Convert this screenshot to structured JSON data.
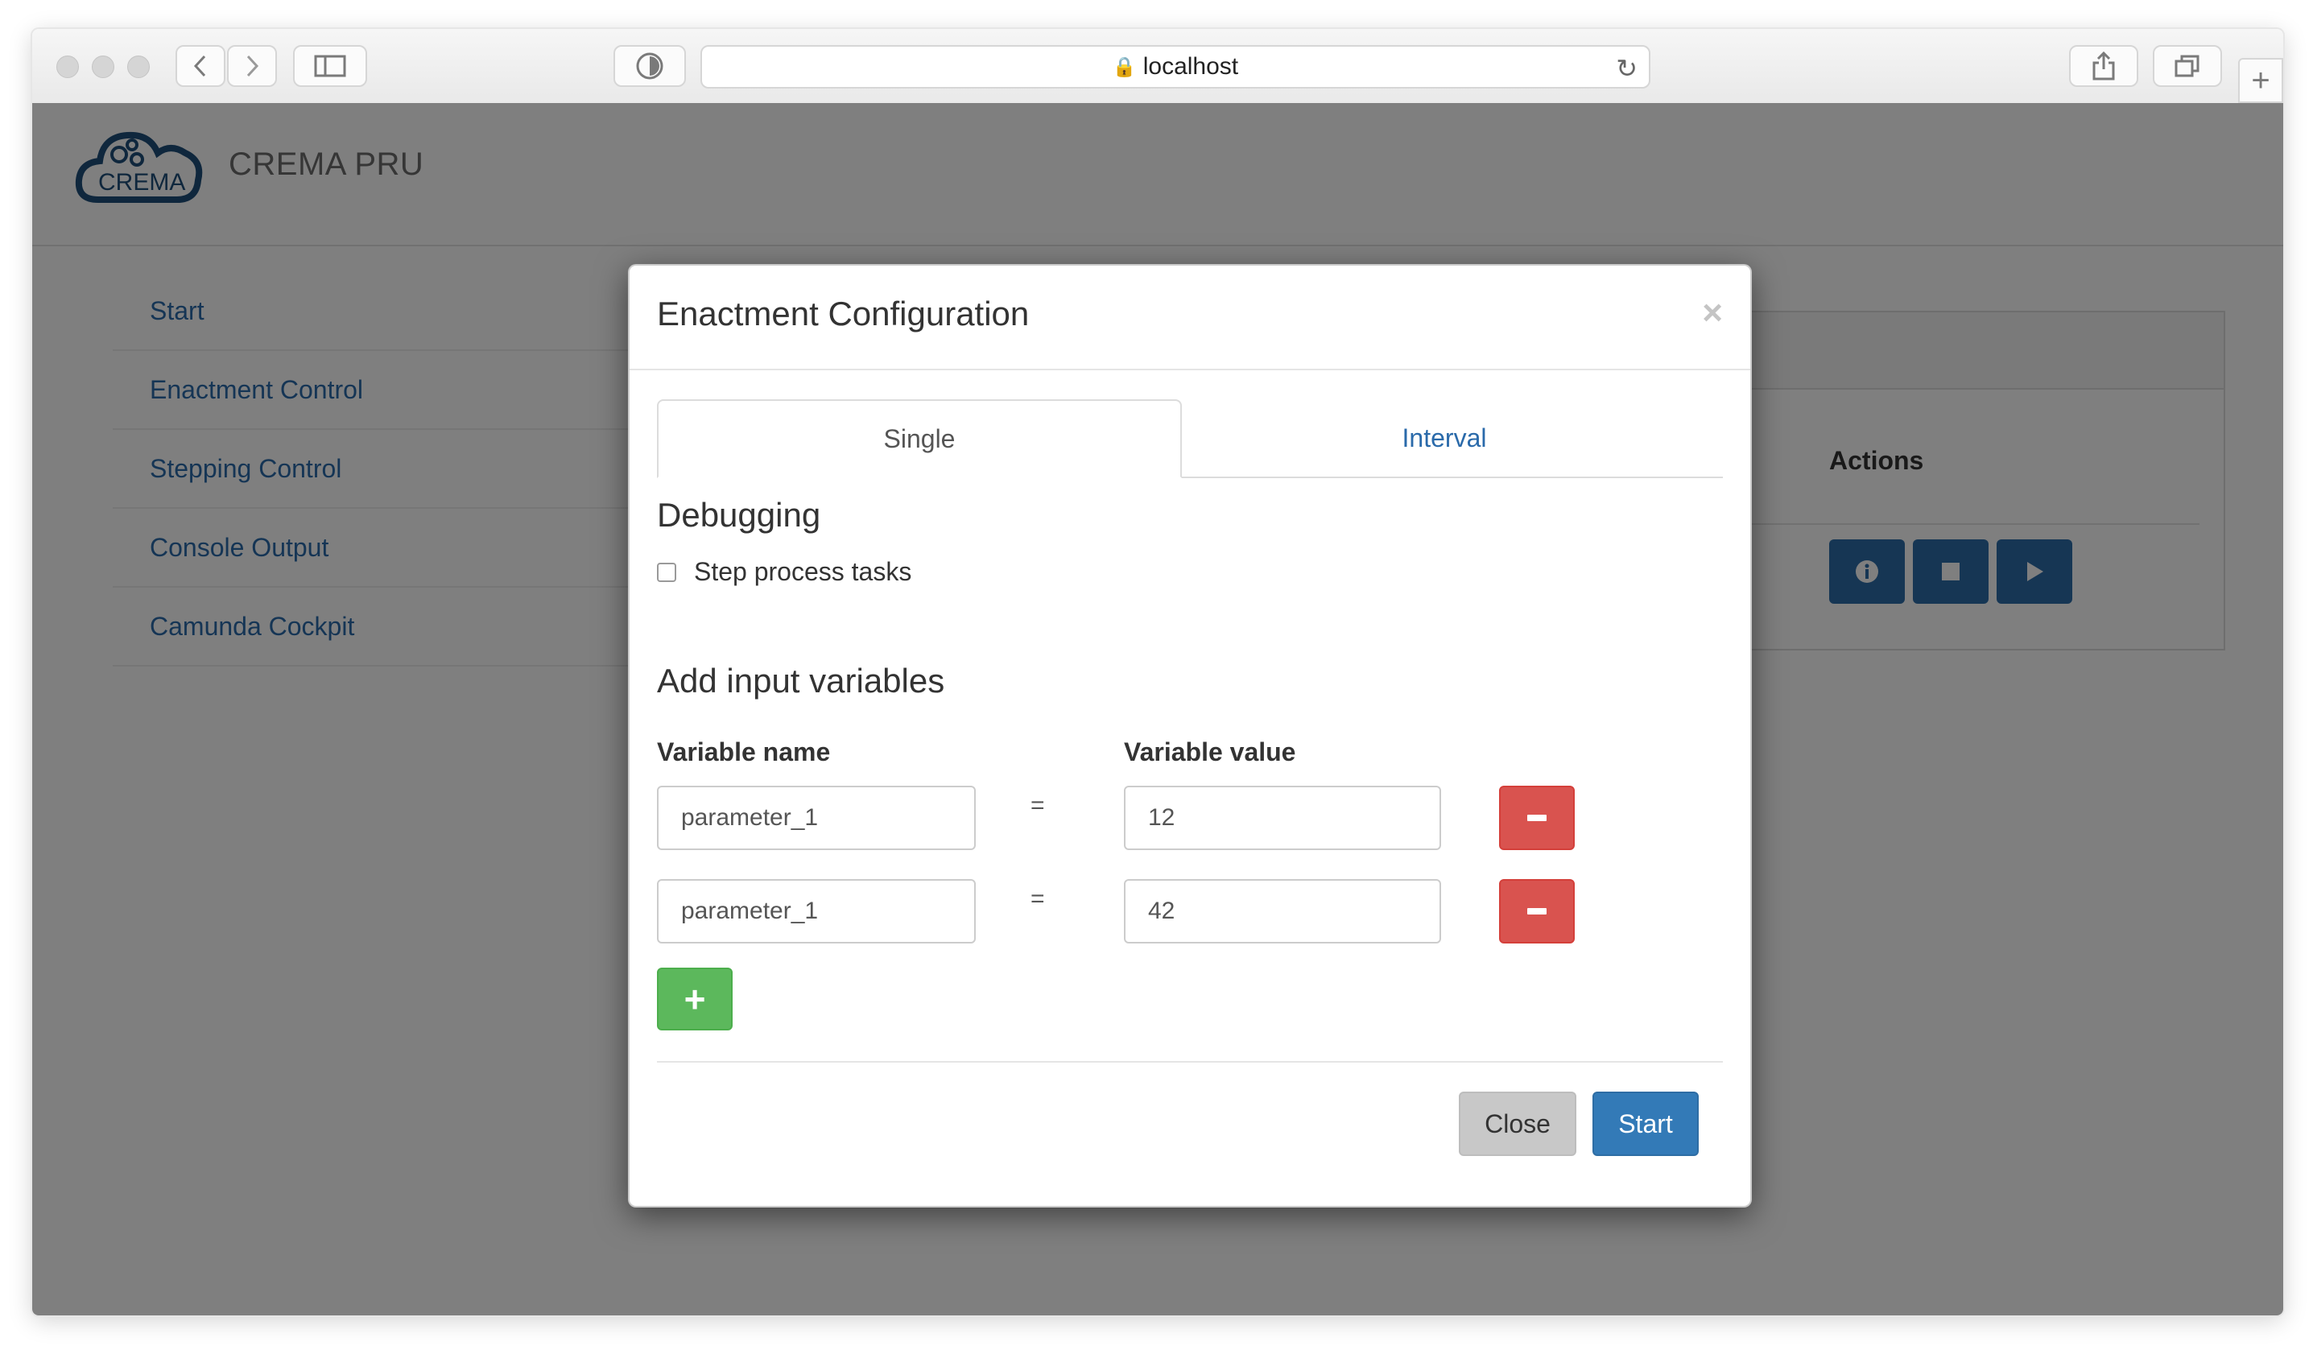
{
  "browser": {
    "url": "localhost"
  },
  "app": {
    "brand": "CREMA PRU",
    "logo_text": "CREMA",
    "nav": [
      {
        "label": "Start"
      },
      {
        "label": "Enactment Control"
      },
      {
        "label": "Stepping Control"
      },
      {
        "label": "Console Output"
      },
      {
        "label": "Camunda Cockpit"
      }
    ],
    "panel": {
      "actions_label": "Actions",
      "action_icons": [
        "info-icon",
        "stop-icon",
        "play-icon"
      ]
    }
  },
  "modal": {
    "title": "Enactment Configuration",
    "close_glyph": "×",
    "tabs": [
      {
        "label": "Single",
        "active": true
      },
      {
        "label": "Interval",
        "active": false
      }
    ],
    "debugging": {
      "title": "Debugging",
      "checkbox_label": "Step process tasks",
      "checked": false
    },
    "variables": {
      "title": "Add input variables",
      "name_header": "Variable name",
      "value_header": "Variable value",
      "equals": "=",
      "rows": [
        {
          "name": "parameter_1",
          "value": "12"
        },
        {
          "name": "parameter_1",
          "value": "42"
        }
      ],
      "add_glyph": "+"
    },
    "footer": {
      "close_label": "Close",
      "start_label": "Start"
    }
  },
  "colors": {
    "primary": "#337ab7",
    "danger": "#d9534f",
    "success": "#5cb85c",
    "link": "#2a6aaa",
    "action": "#2c6da8"
  }
}
